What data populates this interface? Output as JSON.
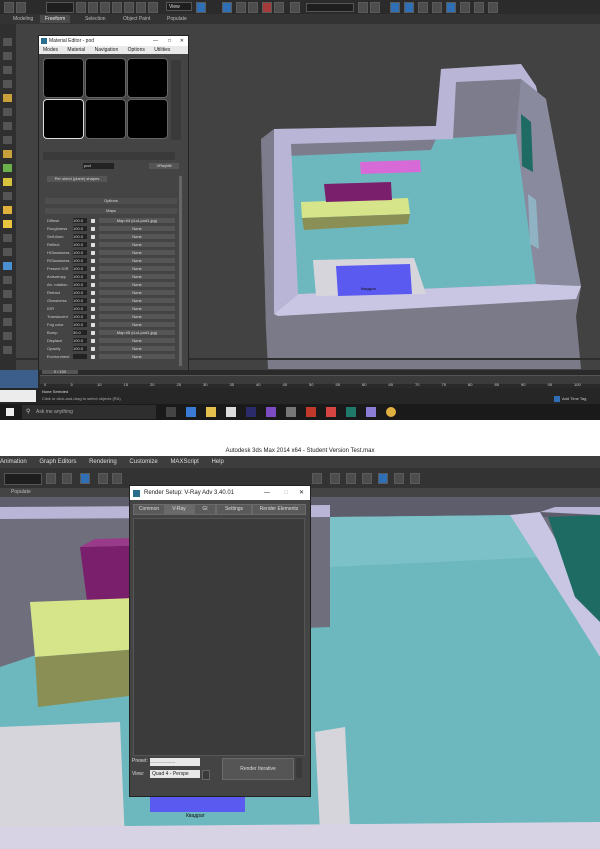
{
  "top_screen": {
    "ribbon_tabs": [
      "Modeling",
      "Freeform",
      "Selection",
      "Object Paint",
      "Populate"
    ],
    "view_dropdown": "View",
    "material_editor": {
      "title": "Material Editor - pod",
      "menu": [
        "Modes",
        "Material",
        "Navigation",
        "Options",
        "Utilities"
      ],
      "material_name": "pod",
      "material_type": "VRayMtl",
      "per_object_label": "Per obect (plane) shapes",
      "rollout_options": "Options",
      "rollout_maps": "Maps",
      "map_rows": [
        {
          "name": "Diffuse",
          "value": "100.0",
          "map": "Map #4 (d-ul-pod1.jpg)"
        },
        {
          "name": "Roughness",
          "value": "100.0",
          "map": "None"
        },
        {
          "name": "Self-illum",
          "value": "100.0",
          "map": "None"
        },
        {
          "name": "Reflect",
          "value": "100.0",
          "map": "None"
        },
        {
          "name": "HGlossiness",
          "value": "100.0",
          "map": "None"
        },
        {
          "name": "RGlossiness",
          "value": "100.0",
          "map": "None"
        },
        {
          "name": "Fresnel IOR",
          "value": "100.0",
          "map": "None"
        },
        {
          "name": "Anisotropy",
          "value": "100.0",
          "map": "None"
        },
        {
          "name": "An. rotation",
          "value": "100.0",
          "map": "None"
        },
        {
          "name": "Refract",
          "value": "100.0",
          "map": "None"
        },
        {
          "name": "Glossiness",
          "value": "100.0",
          "map": "None"
        },
        {
          "name": "IOR",
          "value": "100.0",
          "map": "None"
        },
        {
          "name": "Translucent",
          "value": "100.0",
          "map": "None"
        },
        {
          "name": "Fog color",
          "value": "100.0",
          "map": "None"
        },
        {
          "name": "Bump",
          "value": "30.0",
          "map": "Map #5 (d-ul-pod1.jpg)"
        },
        {
          "name": "Displace",
          "value": "100.0",
          "map": "None"
        },
        {
          "name": "Opacity",
          "value": "100.0",
          "map": "None"
        },
        {
          "name": "Environment",
          "value": "",
          "map": "None"
        }
      ]
    },
    "viewport_label": "Квадрат",
    "timeline_ticks": [
      "0",
      "5",
      "10",
      "15",
      "20",
      "25",
      "30",
      "35",
      "40",
      "45",
      "50",
      "55",
      "60",
      "65",
      "70",
      "75",
      "80",
      "85",
      "90",
      "95",
      "100"
    ],
    "frame_counter": "0 / 100",
    "status_text": "None Selected",
    "status_hint": "Click or click-and-drag to select objects (RA)",
    "add_time_tag": "Add Time Tag",
    "taskbar": {
      "search_placeholder": "Ask me anything"
    }
  },
  "bottom_screen": {
    "window_title": "Autodesk 3ds Max  2014 x64  - Student Version    Test.max",
    "menu": [
      "Animation",
      "Graph Editors",
      "Rendering",
      "Customize",
      "MAXScript",
      "Help"
    ],
    "ribbon_tab": "Populate",
    "render_setup": {
      "title": "Render Setup: V-Ray Adv 3.40.01",
      "tabs": [
        "Common",
        "V-Ray",
        "GI",
        "Settings",
        "Render Elements"
      ],
      "preset_label": "Preset:",
      "preset_value": "-------------------",
      "view_label": "View:",
      "view_value": "Quad 4 - Perspe",
      "render_button": "Render Iterative"
    },
    "viewport_label": "Квадрат"
  },
  "colors": {
    "wall": "#b8b5d6",
    "floor_cyan": "#6db8bf",
    "lime": "#d7e58a",
    "magenta": "#7a1f6b",
    "pink": "#d86ad8",
    "blue_rug": "#5b5af0",
    "teal_window": "#1d6b63"
  }
}
